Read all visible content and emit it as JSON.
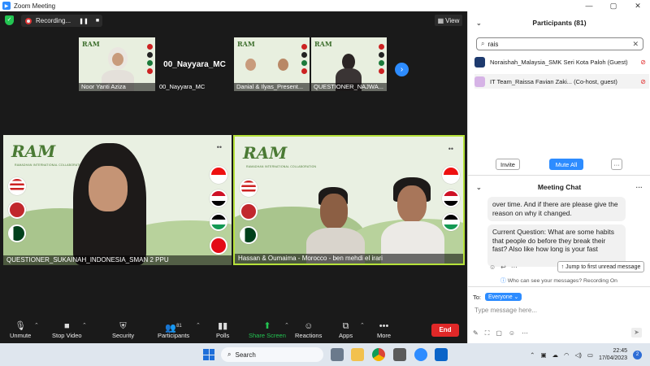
{
  "window": {
    "title": "Zoom Meeting",
    "controls": [
      "—",
      "▢",
      "✕"
    ]
  },
  "topbar": {
    "recording_label": "Recording...",
    "view_label": "View"
  },
  "thumbnails": [
    {
      "name": "Noor Yanti Aziza"
    },
    {
      "name": "00_Nayyara_MC",
      "display_name": "00_Nayyara_MC"
    },
    {
      "name": "Danial & Ilyas_Present..."
    },
    {
      "name": "QUESTIONER_NAJWA..."
    }
  ],
  "videos": {
    "left": {
      "name": "QUESTIONER_SUKAINAH_INDONESIA_SMAN 2 PPU",
      "brand": "RAM",
      "brand_sub": "RAMADHAN INTERNATIONAL COLLABORATION"
    },
    "right": {
      "name": "Hassan & Oumaima - Morocco - ben mehdi el irari",
      "brand": "RAM",
      "brand_sub": "RAMADHAN INTERNATIONAL COLLABORATION"
    }
  },
  "toolbar": {
    "unmute": "Unmute",
    "stop_video": "Stop Video",
    "security": "Security",
    "participants": "Participants",
    "participants_count": "81",
    "polls": "Polls",
    "share_screen": "Share Screen",
    "reactions": "Reactions",
    "apps": "Apps",
    "more": "More",
    "end": "End"
  },
  "participants_panel": {
    "title": "Participants (81)",
    "search_value": "rais",
    "rows": [
      {
        "name": "Noraishah_Malaysia_SMK Seri Kota Paloh (Guest)"
      },
      {
        "name": "IT Team_Raissa Favian Zaki... (Co-host, guest)"
      }
    ],
    "invite": "Invite",
    "mute_all": "Mute All",
    "more": "···"
  },
  "chat_panel": {
    "title": "Meeting Chat",
    "messages": [
      "over time. And if there are please give the reason on why it changed.",
      "Current Question: What are some habits that people do before they break their fast? Also like how long is your fast"
    ],
    "jump_label": "Jump to first unread message",
    "visibility": "Who can see your messages? Recording On",
    "to_label": "To:",
    "to_value": "Everyone",
    "input_placeholder": "Type message here..."
  },
  "taskbar": {
    "search_label": "Search",
    "time": "22:45",
    "date": "17/04/2023",
    "notif_count": "2"
  },
  "colors": {
    "accent": "#2d8cff",
    "end": "#e02828",
    "active_border": "#b6e23a",
    "share": "#23c552"
  }
}
